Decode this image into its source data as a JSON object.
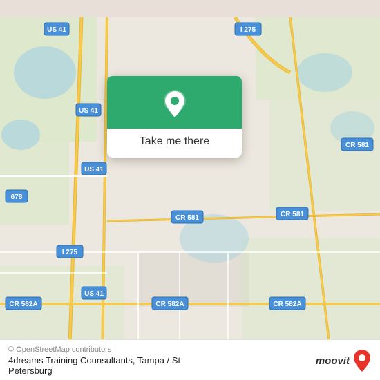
{
  "map": {
    "background_color": "#ede8df",
    "road_color": "#f7c94e",
    "highway_color": "#e6b830",
    "minor_road_color": "#ffffff",
    "water_color": "#aad3df",
    "green_color": "#c8e6c0",
    "label_color": "#555555"
  },
  "popup": {
    "background_color": "#2eaa6e",
    "button_label": "Take me there"
  },
  "footer": {
    "copyright": "© OpenStreetMap contributors",
    "place_name": "4dreams Training Counsultants, Tampa / St",
    "place_city": "Petersburg"
  },
  "road_labels": [
    {
      "id": "i275_top",
      "text": "I 275"
    },
    {
      "id": "us41_top",
      "text": "US 41"
    },
    {
      "id": "us41_mid1",
      "text": "US 41"
    },
    {
      "id": "us41_mid2",
      "text": "US 41"
    },
    {
      "id": "us41_bot",
      "text": "US 41"
    },
    {
      "id": "cr581_top",
      "text": "CR 581"
    },
    {
      "id": "cr581_mid",
      "text": "CR 581"
    },
    {
      "id": "cr581_bot",
      "text": "CR 581"
    },
    {
      "id": "cr582a_left",
      "text": "CR 582A"
    },
    {
      "id": "cr582a_mid",
      "text": "CR 582A"
    },
    {
      "id": "cr582a_right",
      "text": "CR 582A"
    },
    {
      "id": "i275_bot",
      "text": "I 275"
    },
    {
      "id": "r678",
      "text": "678"
    }
  ],
  "moovit": {
    "text": "moovit",
    "pin_color": "#e8332a"
  }
}
